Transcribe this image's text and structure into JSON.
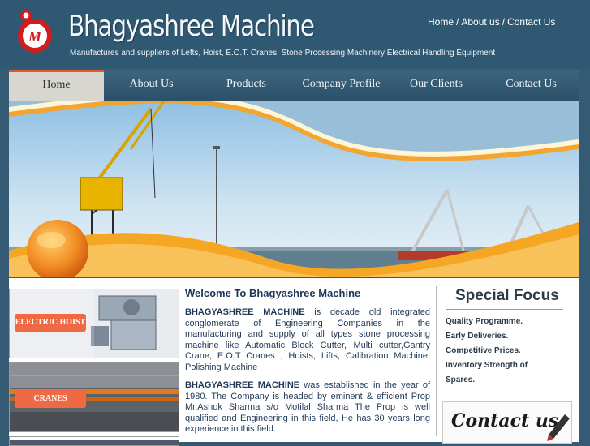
{
  "header": {
    "title": "Bhagyashree Machine",
    "tagline": "Manufactures and suppliers of Lefts, Hoist, E.O.T. Cranes, Stone Processing Machinery Electrical Handling Equipment",
    "top_links": [
      "Home",
      "About us",
      "Contact Us"
    ],
    "logo_letter": "M"
  },
  "nav": {
    "items": [
      "Home",
      "About Us",
      "Products",
      "Company Profile",
      "Our Clients",
      "Contact Us"
    ],
    "active": "Home"
  },
  "thumbnails": [
    {
      "label": "ELECTRIC HOIST"
    },
    {
      "label": "CRANES"
    }
  ],
  "welcome": {
    "title": "Welcome To Bhagyashree Machine",
    "p1_bold": "BHAGYASHREE MACHINE",
    "p1_text": " is decade old integrated conglomerate of Engineering Companies in the manufacturing and supply of all types stone processing machine like Automatic Block Cutter, Multi cutter,Gantry Crane, E.O.T Cranes , Hoists, Lifts, Calibration Machine, Polishing Machine",
    "p2_bold": "BHAGYASHREE MACHINE",
    "p2_text": " was established in the year of 1980. The Company is headed by eminent & efficient Prop Mr.Ashok Sharma s/o Motilal Sharma The Prop is well qualified and Engineering in this field, He has 30 years long experience in this field."
  },
  "special_focus": {
    "title": "Special Focus",
    "items": [
      "Quality Programme.",
      "Early Deliveries.",
      "Competitive Prices.",
      "Inventory Strength of Spares."
    ]
  },
  "contact_box": {
    "text": "Contact us"
  },
  "colors": {
    "page_bg": "#355a73",
    "accent": "#ef6a44",
    "nav_active_bg": "#d7d7cf",
    "text_navy": "#1d3658"
  }
}
